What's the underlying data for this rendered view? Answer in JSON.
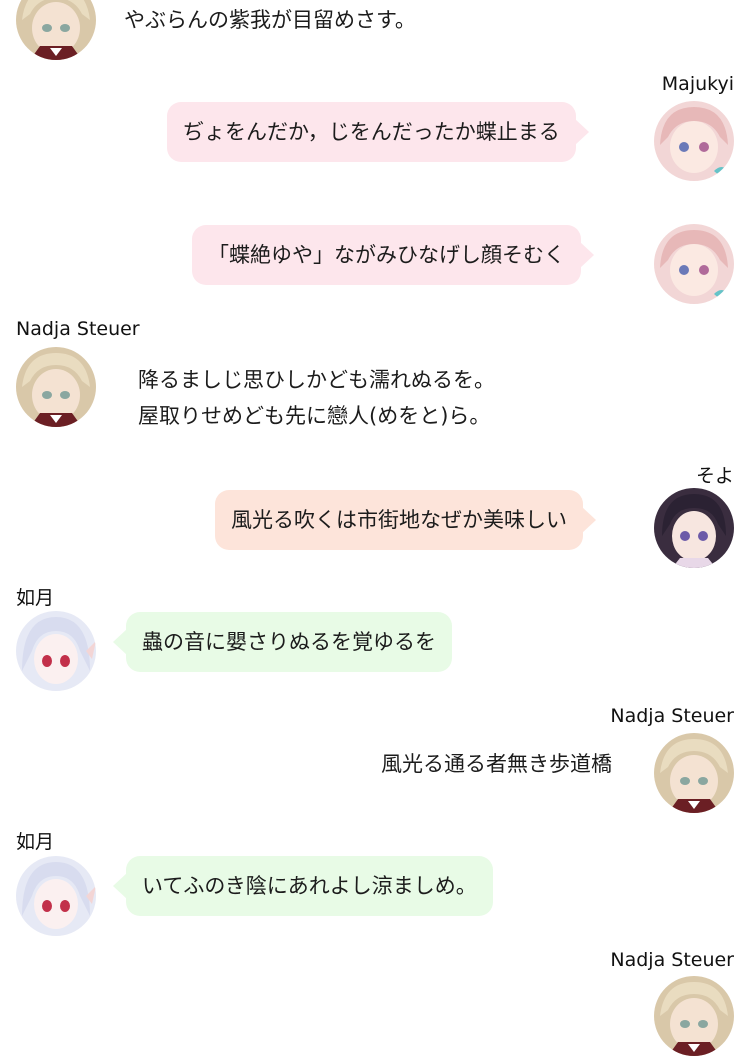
{
  "messages": [
    {
      "sender": "",
      "avatar": "blonde-girl-avatar",
      "lines": [
        "やぶらんの紫我が目留めさす。"
      ]
    },
    {
      "sender": "Majukyi",
      "avatar": "pink-hair-girl-avatar",
      "lines": [
        "ぢょをんだか，じをんだったか蝶止まる"
      ]
    },
    {
      "sender": "",
      "avatar": "pink-hair-girl-avatar",
      "lines": [
        "「蝶絶ゆや」ながみひなげし顔そむく"
      ]
    },
    {
      "sender": "Nadja Steuer",
      "avatar": "blonde-girl-avatar",
      "lines": [
        "降るましじ思ひしかども濡れぬるを。",
        "屋取りせめども先に戀人(めをと)ら。"
      ]
    },
    {
      "sender": "そよ",
      "avatar": "dark-hair-girl-avatar",
      "lines": [
        "風光る吹くは市街地なぜか美味しい"
      ]
    },
    {
      "sender": "如月",
      "avatar": "silver-hair-girl-avatar",
      "lines": [
        "蟲の音に嬰さりぬるを覚ゆるを"
      ]
    },
    {
      "sender": "Nadja Steuer",
      "avatar": "blonde-girl-avatar",
      "lines": [
        "風光る通る者無き歩道橋"
      ]
    },
    {
      "sender": "如月",
      "avatar": "silver-hair-girl-avatar",
      "lines": [
        "いてふのき陰にあれよし涼ましめ。"
      ]
    },
    {
      "sender": "Nadja Steuer",
      "avatar": "blonde-girl-avatar",
      "lines": []
    }
  ],
  "colors": {
    "pink_bubble": "#fde6ec",
    "peach_bubble": "#fde4da",
    "green_bubble": "#e8fbe6"
  }
}
